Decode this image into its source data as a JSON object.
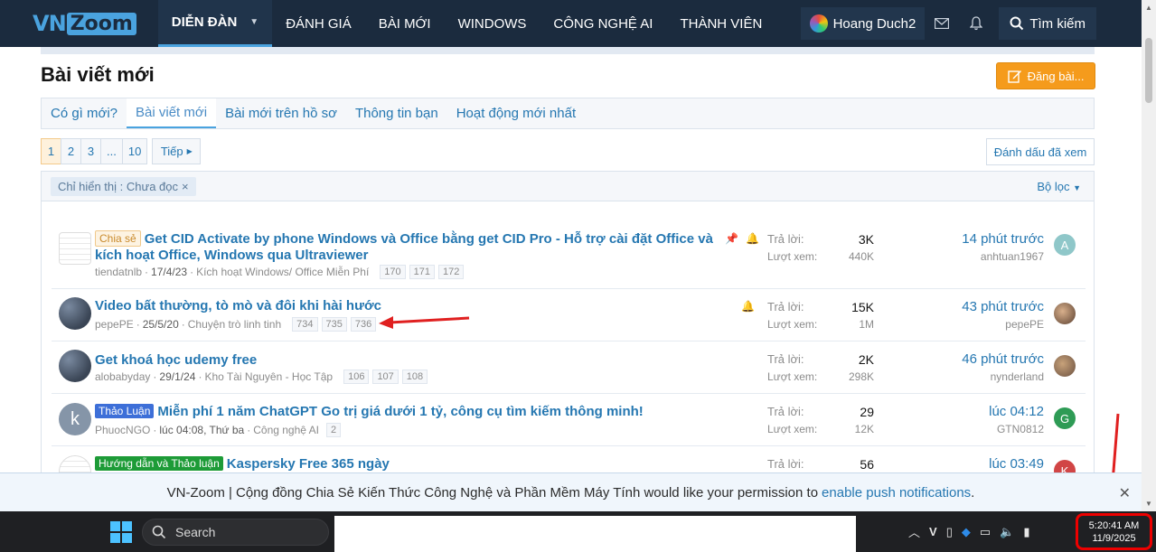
{
  "nav": {
    "logo_vn": "VN",
    "logo_zoom": "Zoom",
    "items": [
      "DIỄN ĐÀN",
      "ĐÁNH GIÁ",
      "BÀI MỚI",
      "WINDOWS",
      "CÔNG NGHỆ AI",
      "THÀNH VIÊN"
    ],
    "user": "Hoang Duch2",
    "search": "Tìm kiếm"
  },
  "page": {
    "title": "Bài viết mới",
    "post_button": "Đăng bài..."
  },
  "tabs": [
    "Có gì mới?",
    "Bài viết mới",
    "Bài mới trên hồ sơ",
    "Thông tin bạn",
    "Hoạt động mới nhất"
  ],
  "pager": {
    "pages": [
      "1",
      "2",
      "3",
      "...",
      "10"
    ],
    "next": "Tiếp",
    "mark_read": "Đánh dấu đã xem"
  },
  "filter": {
    "chip": "Chỉ hiển thị : Chưa đọc",
    "toggle": "Bộ lọc"
  },
  "threads": [
    {
      "label": "Chia sẻ",
      "title": "Get CID Activate by phone Windows và Office bằng get CID Pro - Hỗ trợ cài đặt Office và kích hoạt Office, Windows qua Ultraviewer",
      "author": "tiendatnlb",
      "date": "17/4/23",
      "forum": "Kích hoạt Windows/ Office Miễn Phí",
      "pages": [
        "170",
        "171",
        "172"
      ],
      "replies_label": "Trả lời:",
      "replies": "3K",
      "views_label": "Lượt xem:",
      "views": "440K",
      "last_time": "14 phút trước",
      "last_user": "anhtuan1967",
      "avatar_letter": "A"
    },
    {
      "title": "Video bất thường, tò mò và đôi khi hài hước",
      "author": "pepePE",
      "date": "25/5/20",
      "forum": "Chuyện trò linh tinh",
      "pages": [
        "734",
        "735",
        "736"
      ],
      "replies_label": "Trả lời:",
      "replies": "15K",
      "views_label": "Lượt xem:",
      "views": "1M",
      "last_time": "43 phút trước",
      "last_user": "pepePE"
    },
    {
      "title": "Get khoá học udemy free",
      "author": "alobabyday",
      "date": "29/1/24",
      "forum": "Kho Tài Nguyên - Học Tập",
      "pages": [
        "106",
        "107",
        "108"
      ],
      "replies_label": "Trả lời:",
      "replies": "2K",
      "views_label": "Lượt xem:",
      "views": "298K",
      "last_time": "46 phút trước",
      "last_user": "nynderland"
    },
    {
      "label": "Thảo Luận",
      "title": "Miễn phí 1 năm ChatGPT Go trị giá dưới 1 tỷ, công cụ tìm kiếm thông minh!",
      "author": "PhuocNGO",
      "date": "lúc 04:08, Thứ ba",
      "forum": "Công nghệ AI",
      "pages": [
        "2"
      ],
      "replies_label": "Trả lời:",
      "replies": "29",
      "views_label": "Lượt xem:",
      "views": "12K",
      "last_time": "lúc 04:12",
      "last_user": "GTN0812",
      "thumb_letter": "k",
      "avatar_letter": "G"
    },
    {
      "label": "Hướng dẫn và Thảo luận",
      "title": "Kaspersky Free 365 ngày",
      "replies_label": "Trả lời:",
      "replies": "56",
      "last_time": "lúc 03:49",
      "avatar_letter": "K"
    }
  ],
  "push": {
    "text": "VN-Zoom | Cộng đồng Chia Sẻ Kiến Thức Công Nghệ và Phần Mềm Máy Tính would like your permission to",
    "link": "enable push notifications",
    "suffix": "."
  },
  "taskbar": {
    "search": "Search",
    "time": "5:20:41 AM",
    "date": "11/9/2025"
  },
  "colors": {
    "nav_bg": "#1b2b3e",
    "link": "#2577b1",
    "accent": "#f59b1c"
  }
}
